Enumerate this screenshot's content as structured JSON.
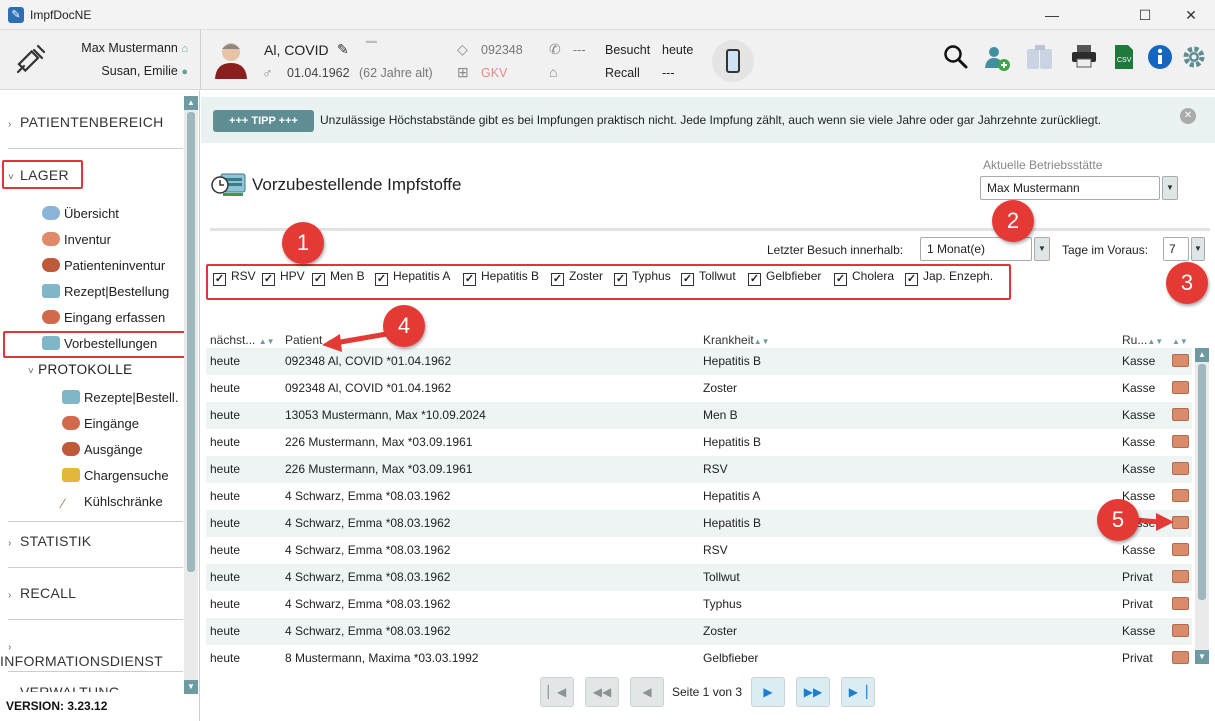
{
  "window": {
    "title": "ImpfDocNE"
  },
  "header": {
    "user_name": "Max Mustermann",
    "user_sub": "Susan, Emilie",
    "patient_name": "Al, COVID",
    "patient_dob": "01.04.1962",
    "patient_age": "(62 Jahre alt)",
    "patient_id": "092348",
    "insurance": "GKV",
    "phone": "---",
    "visited_label": "Besucht",
    "visited_value": "heute",
    "recall_label": "Recall",
    "recall_value": "---"
  },
  "sidebar": {
    "sections": {
      "patientenbereich": "PATIENTENBEREICH",
      "lager": "LAGER",
      "statistik": "STATISTIK",
      "recall": "RECALL",
      "informationsdienst": "INFORMATIONSDIENST",
      "verwaltung": "VERWALTUNG"
    },
    "lager_items": [
      "Übersicht",
      "Inventur",
      "Patienteninventur",
      "Rezept|Bestellung",
      "Eingang erfassen",
      "Vorbestellungen"
    ],
    "protokolle_label": "PROTOKOLLE",
    "protokolle_items": [
      "Rezepte|Bestell.",
      "Eingänge",
      "Ausgänge",
      "Chargensuche",
      "Kühlschränke"
    ],
    "version": "VERSION: 3.23.12"
  },
  "tip": {
    "badge": "+++ TIPP +++",
    "text": "Unzulässige Höchstabstände gibt es bei Impfungen praktisch nicht. Jede Impfung zählt, auch wenn sie viele Jahre oder gar Jahrzehnte zurückliegt."
  },
  "page": {
    "title": "Vorzubestellende Impfstoffe",
    "site_label": "Aktuelle Betriebsstätte",
    "site_value": "Max Mustermann",
    "last_visit_label": "Letzter Besuch innerhalb:",
    "last_visit_value": "1 Monat(e)",
    "days_ahead_label": "Tage im Voraus:",
    "days_ahead_value": "7"
  },
  "filters": [
    {
      "label": "RSV",
      "checked": true
    },
    {
      "label": "HPV",
      "checked": true
    },
    {
      "label": "Men B",
      "checked": true
    },
    {
      "label": "Hepatitis A",
      "checked": true
    },
    {
      "label": "Hepatitis B",
      "checked": true
    },
    {
      "label": "Zoster",
      "checked": true
    },
    {
      "label": "Typhus",
      "checked": true
    },
    {
      "label": "Tollwut",
      "checked": true
    },
    {
      "label": "Gelbfieber",
      "checked": true
    },
    {
      "label": "Cholera",
      "checked": true
    },
    {
      "label": "Jap. Enzeph.",
      "checked": true
    }
  ],
  "table": {
    "headers": {
      "next": "nächst...",
      "patient": "Patient",
      "disease": "Krankheit",
      "ru": "Ru..."
    },
    "rows": [
      {
        "next": "heute",
        "patient": "092348 Al, COVID *01.04.1962",
        "disease": "Hepatitis B",
        "ru": "Kasse"
      },
      {
        "next": "heute",
        "patient": "092348 Al, COVID *01.04.1962",
        "disease": "Zoster",
        "ru": "Kasse"
      },
      {
        "next": "heute",
        "patient": "13053 Mustermann, Max *10.09.2024",
        "disease": "Men B",
        "ru": "Kasse"
      },
      {
        "next": "heute",
        "patient": "226 Mustermann, Max *03.09.1961",
        "disease": "Hepatitis B",
        "ru": "Kasse"
      },
      {
        "next": "heute",
        "patient": "226 Mustermann, Max *03.09.1961",
        "disease": "RSV",
        "ru": "Kasse"
      },
      {
        "next": "heute",
        "patient": "4 Schwarz, Emma *08.03.1962",
        "disease": "Hepatitis A",
        "ru": "Kasse"
      },
      {
        "next": "heute",
        "patient": "4 Schwarz, Emma *08.03.1962",
        "disease": "Hepatitis B",
        "ru": "Kasse"
      },
      {
        "next": "heute",
        "patient": "4 Schwarz, Emma *08.03.1962",
        "disease": "RSV",
        "ru": "Kasse"
      },
      {
        "next": "heute",
        "patient": "4 Schwarz, Emma *08.03.1962",
        "disease": "Tollwut",
        "ru": "Privat"
      },
      {
        "next": "heute",
        "patient": "4 Schwarz, Emma *08.03.1962",
        "disease": "Typhus",
        "ru": "Privat"
      },
      {
        "next": "heute",
        "patient": "4 Schwarz, Emma *08.03.1962",
        "disease": "Zoster",
        "ru": "Kasse"
      },
      {
        "next": "heute",
        "patient": "8 Mustermann,  Maxima *03.03.1992",
        "disease": "Gelbfieber",
        "ru": "Privat"
      }
    ]
  },
  "pager": {
    "text": "Seite 1 von 3"
  },
  "annotations": [
    "1",
    "2",
    "3",
    "4",
    "5"
  ],
  "colors": {
    "accent": "#6e9ba3",
    "highlight": "#e0363b",
    "alt_row": "#eef3f3"
  }
}
